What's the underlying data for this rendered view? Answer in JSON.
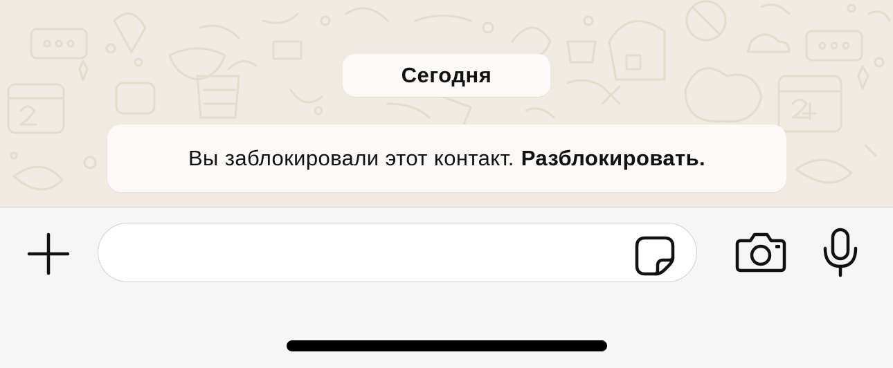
{
  "chat": {
    "date_label": "Сегодня",
    "system_message": {
      "text": "Вы заблокировали этот контакт.",
      "action_label": "Разблокировать."
    }
  },
  "composer": {
    "message_value": "",
    "message_placeholder": "",
    "icons": {
      "attach": "plus-icon",
      "sticker": "sticker-icon",
      "camera": "camera-icon",
      "microphone": "microphone-icon"
    }
  },
  "colors": {
    "chat_background": "#efeae2",
    "bubble": "#fbfaf8",
    "input_bar": "#f6f6f6",
    "text": "#111111"
  }
}
